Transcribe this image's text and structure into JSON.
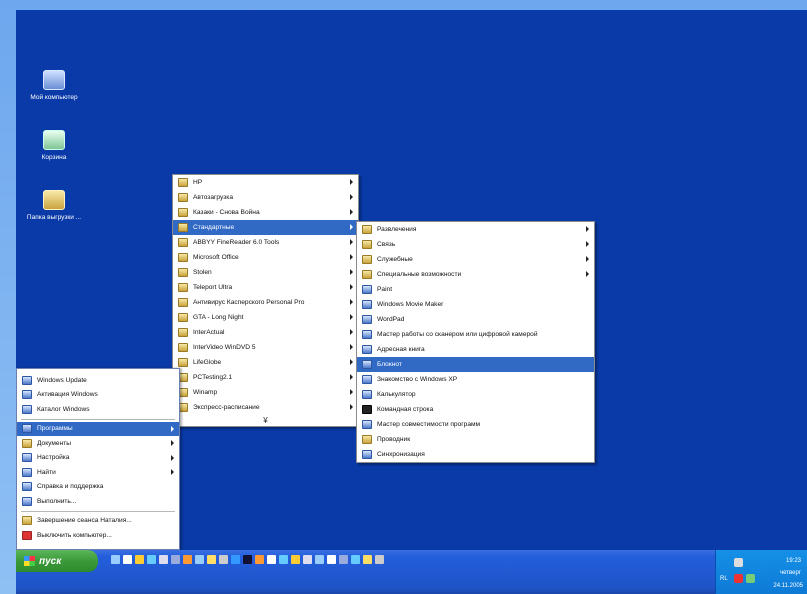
{
  "desktop": {
    "icons": [
      {
        "label": "Мой компьютер",
        "icon": "my-computer-icon"
      },
      {
        "label": "Корзина",
        "icon": "recycle-bin-icon"
      },
      {
        "label": "Папка выгрузки ...",
        "icon": "folder-icon"
      }
    ]
  },
  "start_menu": {
    "top_items": [
      "Windows Update",
      "Активация Windows",
      "Каталог Windows"
    ],
    "main_items": [
      "Программы",
      "Документы",
      "Настройка",
      "Найти",
      "Справка и поддержка",
      "Выполнить..."
    ],
    "bottom_items": [
      "Завершение сеанса Наталия...",
      "Выключить компьютер..."
    ]
  },
  "programs_menu": {
    "items": [
      "HP",
      "Автозагрузка",
      "Казаки - Снова Война",
      "Стандартные",
      "ABBYY FineReader 6.0 Tools",
      "Microsoft Office",
      "Stolen",
      "Teleport Ultra",
      "Антивирус Касперского Personal Pro",
      "GTA - Long Night",
      "InterActual",
      "InterVideo WinDVD 5",
      "LifeGlobe",
      "PCTesting2.1",
      "Winamp",
      "Экспресс-расписание"
    ],
    "more": "¥"
  },
  "accessories_menu": {
    "items": [
      "Развлечения",
      "Связь",
      "Служебные",
      "Специальные возможности",
      "Paint",
      "Windows Movie Maker",
      "WordPad",
      "Мастер работы со сканером или цифровой камерой",
      "Адресная книга",
      "Блокнот",
      "Знакомство с Windows XP",
      "Калькулятор",
      "Командная строка",
      "Мастер совместимости программ",
      "Проводник",
      "Синхронизация"
    ]
  },
  "taskbar": {
    "start_label": "пуск",
    "tray": {
      "lang": "RL",
      "time": "19:23",
      "day": "четверг",
      "date": "24.11.2005"
    }
  },
  "colors": {
    "desktop": "#0a3aa8",
    "highlight": "#316ac5",
    "taskbar": "#245edb",
    "start_button": "#3c9a3a"
  }
}
